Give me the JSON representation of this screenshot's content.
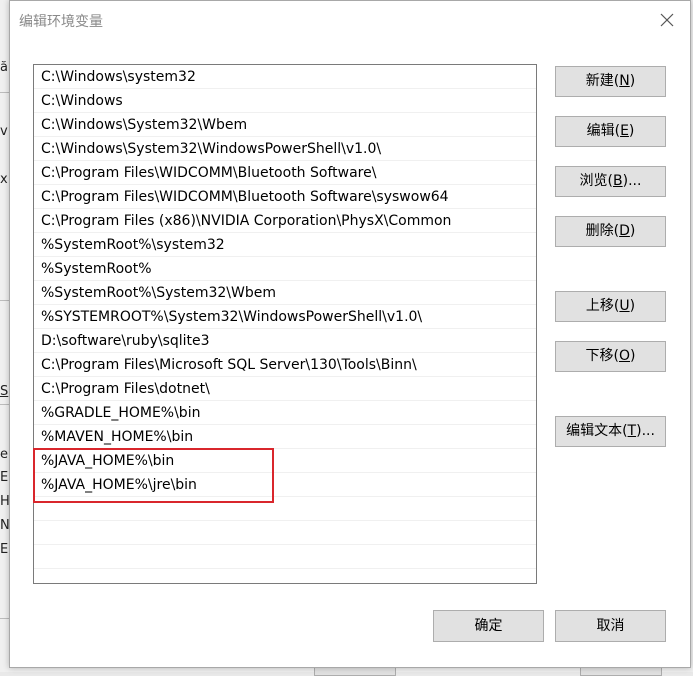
{
  "dialog": {
    "title": "编辑环境变量",
    "close_label": "✕"
  },
  "background_fragments": [
    "ă",
    "v",
    "x",
    "S",
    "e",
    "E",
    "H",
    "N",
    "EF"
  ],
  "path_list": {
    "items": [
      "C:\\Windows\\system32",
      "C:\\Windows",
      "C:\\Windows\\System32\\Wbem",
      "C:\\Windows\\System32\\WindowsPowerShell\\v1.0\\",
      "C:\\Program Files\\WIDCOMM\\Bluetooth Software\\",
      "C:\\Program Files\\WIDCOMM\\Bluetooth Software\\syswow64",
      "C:\\Program Files (x86)\\NVIDIA Corporation\\PhysX\\Common",
      "%SystemRoot%\\system32",
      "%SystemRoot%",
      "%SystemRoot%\\System32\\Wbem",
      "%SYSTEMROOT%\\System32\\WindowsPowerShell\\v1.0\\",
      "D:\\software\\ruby\\sqlite3",
      "C:\\Program Files\\Microsoft SQL Server\\130\\Tools\\Binn\\",
      "C:\\Program Files\\dotnet\\",
      "%GRADLE_HOME%\\bin",
      "%MAVEN_HOME%\\bin",
      "%JAVA_HOME%\\bin",
      "%JAVA_HOME%\\jre\\bin"
    ],
    "highlighted_items": [
      16,
      17
    ],
    "highlight_color": "#d9262c"
  },
  "buttons": {
    "new": {
      "label": "新建(",
      "accel": "N",
      "suffix": ")"
    },
    "edit": {
      "label": "编辑(",
      "accel": "E",
      "suffix": ")"
    },
    "browse": {
      "label": "浏览(",
      "accel": "B",
      "suffix": ")..."
    },
    "delete": {
      "label": "删除(",
      "accel": "D",
      "suffix": ")"
    },
    "move_up": {
      "label": "上移(",
      "accel": "U",
      "suffix": ")"
    },
    "move_down": {
      "label": "下移(",
      "accel": "O",
      "suffix": ")"
    },
    "edit_text": {
      "label": "编辑文本(",
      "accel": "T",
      "suffix": ")..."
    },
    "ok": {
      "label": "确定"
    },
    "cancel": {
      "label": "取消"
    }
  }
}
